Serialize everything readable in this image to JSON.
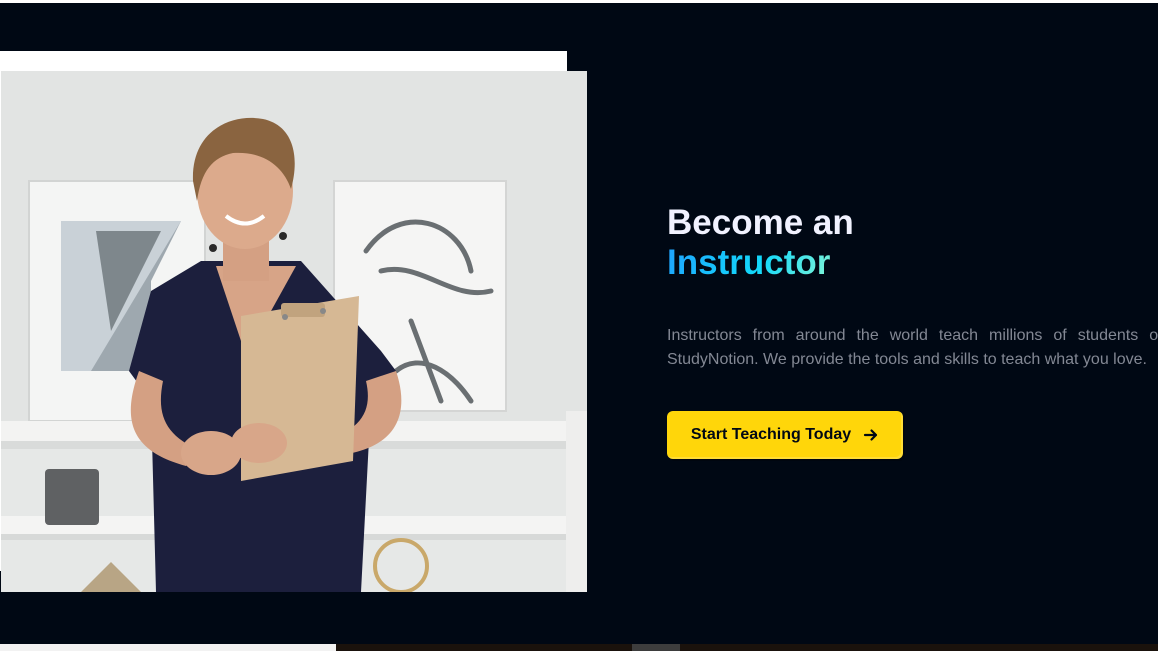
{
  "hero": {
    "heading_prefix": "Become an",
    "heading_highlight": "Instructor",
    "description": "Instructors from around the world teach millions of students on StudyNotion. We provide the tools and skills to teach what you love.",
    "cta_label": "Start Teaching Today",
    "cta_icon": "arrow-right-icon",
    "photo_alt": "instructor"
  },
  "colors": {
    "background": "#000814",
    "heading": "#f1f2ff",
    "highlight_gradient": [
      "#1fa2ff",
      "#12d8fa",
      "#a6ffcb"
    ],
    "description": "#838894",
    "cta_background": "#ffd60a",
    "cta_text": "#000814"
  }
}
